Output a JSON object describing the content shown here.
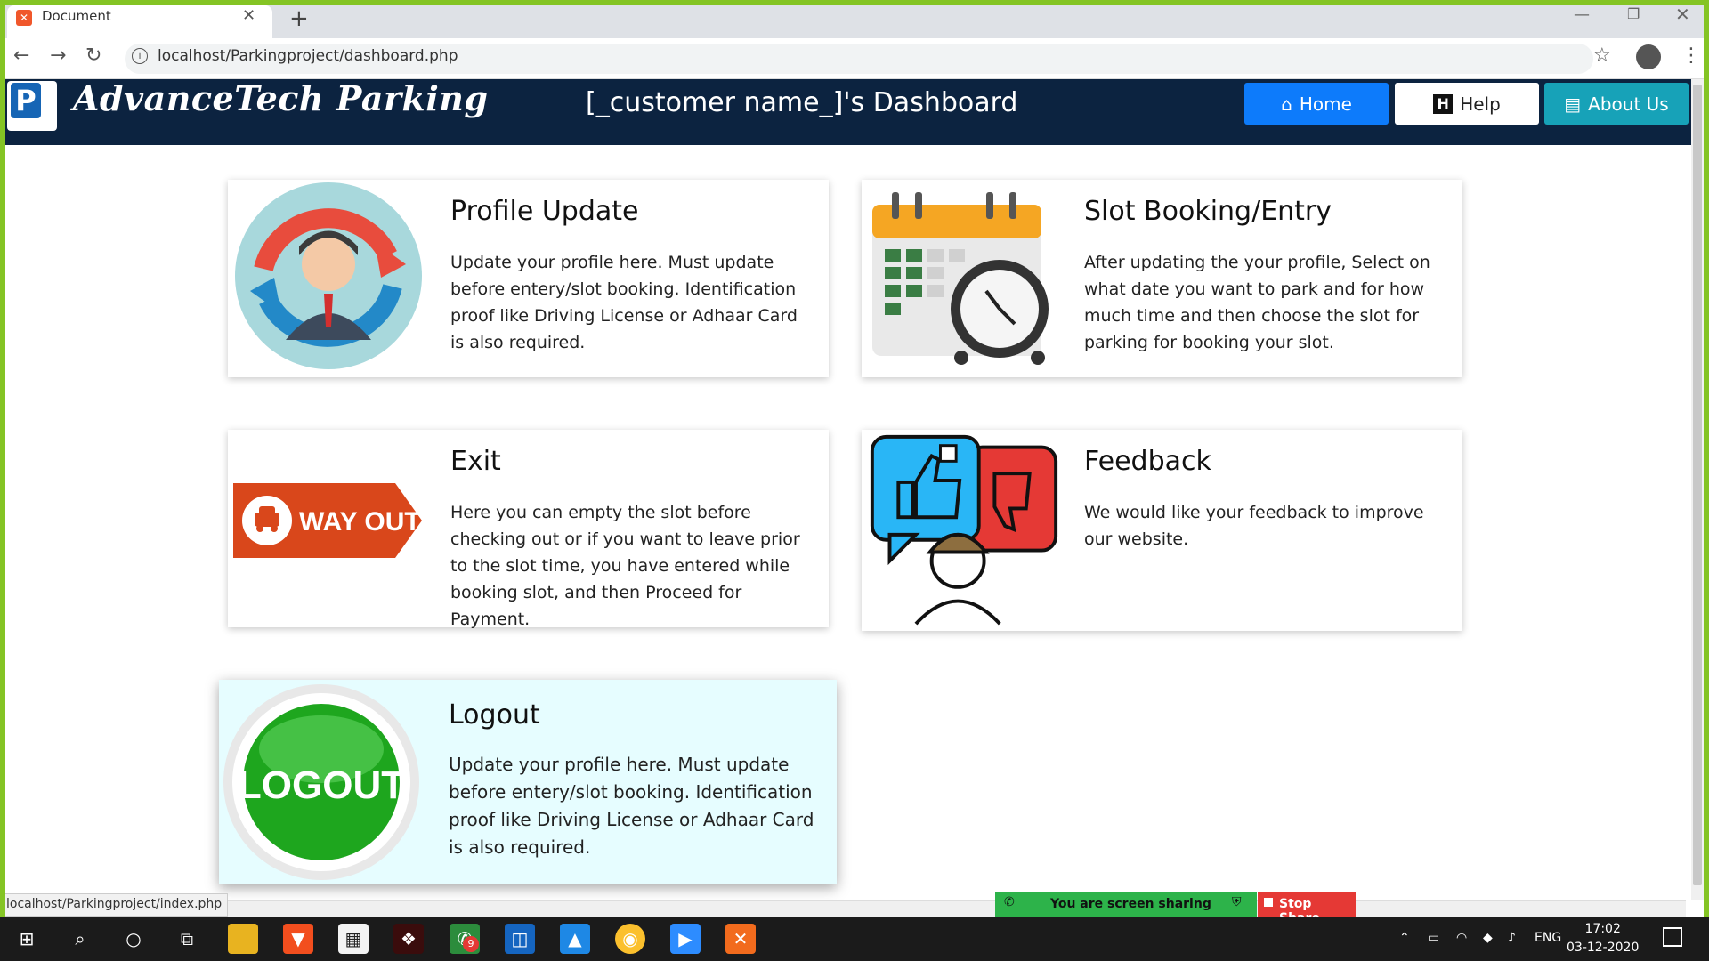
{
  "browser": {
    "tab_title": "Document",
    "url": "localhost/Parkingproject/dashboard.php",
    "status_url": "localhost/Parkingproject/index.php"
  },
  "header": {
    "brand": "AdvanceTech Parking",
    "title": "[_customer name_]'s Dashboard",
    "nav": {
      "home": "Home",
      "help": "Help",
      "about": "About Us"
    }
  },
  "cards": {
    "profile": {
      "title": "Profile Update",
      "text": "Update your profile here. Must update before entery/slot booking. Identification proof like Driving License or Adhaar Card is also required."
    },
    "slot": {
      "title": "Slot Booking/Entry",
      "text": "After updating the your profile, Select on what date you want to park and for how much time and then choose the slot for parking for booking your slot."
    },
    "exit": {
      "title": "Exit",
      "text": "Here you can empty the slot before checking out or if you want to leave prior to the slot time, you have entered while booking slot, and then Proceed for Payment.",
      "image_text": "WAY OUT"
    },
    "feedback": {
      "title": "Feedback",
      "text": "We would like your feedback to improve our website."
    },
    "logout": {
      "title": "Logout",
      "text": "Update your profile here. Must update before entery/slot booking. Identification proof like Driving License or Adhaar Card is also required.",
      "image_text": "LOGOUT"
    }
  },
  "screen_share": {
    "status": "You are screen sharing",
    "stop": "Stop Share"
  },
  "taskbar": {
    "lang": "ENG",
    "time": "17:02",
    "date": "03-12-2020",
    "badge": "9"
  },
  "colors": {
    "header_bg": "#0c2340",
    "home_btn": "#0d7bfb",
    "about_btn": "#17a2b8",
    "logout_card": "#e6fdff",
    "frame": "#84c424"
  }
}
